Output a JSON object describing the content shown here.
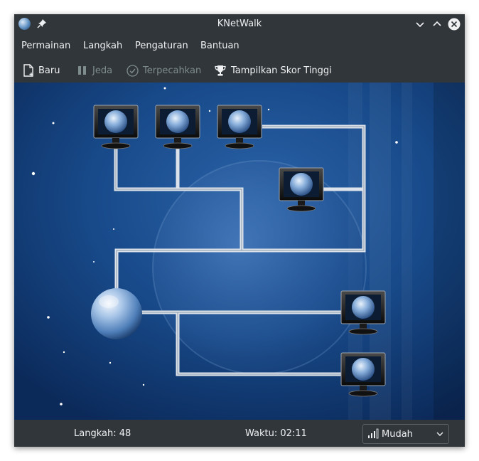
{
  "window": {
    "title": "KNetWalk"
  },
  "menu": [
    "Permainan",
    "Langkah",
    "Pengaturan",
    "Bantuan"
  ],
  "toolbar": {
    "new_label": "Baru",
    "pause_label": "Jeda",
    "solve_label": "Terpecahkan",
    "highscores_label": "Tampilkan Skor Tinggi"
  },
  "status": {
    "moves": "Langkah: 48",
    "time": "Waktu: 02:11",
    "difficulty": "Mudah"
  },
  "colors": {
    "chrome": "#31363b",
    "text": "#eff0f1",
    "disabled_text": "#7f8c8d",
    "board_dark": "#0b2a5a",
    "board_light": "#2a63a8",
    "cable": "#dde3ea"
  },
  "icons": [
    "app-globe-icon",
    "pin-icon",
    "minimize-icon",
    "maximize-icon",
    "close-icon",
    "new-document-icon",
    "pause-icon",
    "solved-check-icon",
    "trophy-icon",
    "difficulty-bars-icon",
    "chevron-down-icon",
    "server-globe-icon",
    "computer-monitor-icon"
  ]
}
